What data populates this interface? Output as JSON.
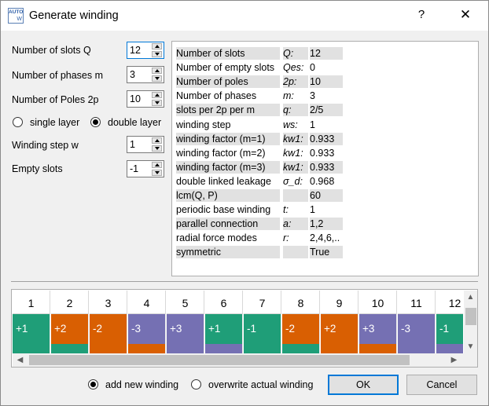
{
  "window": {
    "title": "Generate winding",
    "icon_text_top": "AUTO",
    "icon_text_bottom": "W",
    "help": "?",
    "close": "✕"
  },
  "params": {
    "slots_label": "Number of slots Q",
    "slots_value": "12",
    "phases_label": "Number of phases m",
    "phases_value": "3",
    "poles_label": "Number of Poles 2p",
    "poles_value": "10",
    "single_layer_label": "single layer",
    "double_layer_label": "double layer",
    "layer_selected": "double",
    "step_label": "Winding step w",
    "step_value": "1",
    "empty_label": "Empty slots",
    "empty_value": "-1"
  },
  "info_rows": [
    {
      "name": "Number of slots",
      "sym": "Q:",
      "val": "12",
      "shaded": true
    },
    {
      "name": "Number of empty slots",
      "sym": "Qes:",
      "val": "0",
      "shaded": false
    },
    {
      "name": "Number of poles",
      "sym": "2p:",
      "val": "10",
      "shaded": true
    },
    {
      "name": "Number of phases",
      "sym": "m:",
      "val": "3",
      "shaded": false
    },
    {
      "name": "slots per 2p per m",
      "sym": "q:",
      "val": "2/5",
      "shaded": true
    },
    {
      "name": "winding step",
      "sym": "ws:",
      "val": "1",
      "shaded": false
    },
    {
      "name": "winding factor (m=1)",
      "sym": "kw1:",
      "val": "0.933",
      "shaded": true
    },
    {
      "name": "winding factor (m=2)",
      "sym": "kw1:",
      "val": "0.933",
      "shaded": false
    },
    {
      "name": "winding factor (m=3)",
      "sym": "kw1:",
      "val": "0.933",
      "shaded": true
    },
    {
      "name": "double linked leakage",
      "sym": "σ_d:",
      "val": "0.968",
      "shaded": false
    },
    {
      "name": "lcm(Q, P)",
      "sym": "",
      "val": "60",
      "shaded": true
    },
    {
      "name": "periodic base winding",
      "sym": "t:",
      "val": "1",
      "shaded": false
    },
    {
      "name": "parallel connection",
      "sym": "a:",
      "val": "1,2",
      "shaded": true
    },
    {
      "name": "radial force modes",
      "sym": "r:",
      "val": "2,4,6,..",
      "shaded": false
    },
    {
      "name": "symmetric",
      "sym": "",
      "val": "True",
      "shaded": true
    }
  ],
  "slots": [
    {
      "num": "1",
      "top": "+1",
      "top_color": "#1f9e78",
      "bottom_color": "#1f9e78"
    },
    {
      "num": "2",
      "top": "+2",
      "top_color": "#d95f02",
      "bottom_color": "#1f9e78"
    },
    {
      "num": "3",
      "top": "-2",
      "top_color": "#d95f02",
      "bottom_color": "#d95f02"
    },
    {
      "num": "4",
      "top": "-3",
      "top_color": "#7570b3",
      "bottom_color": "#d95f02"
    },
    {
      "num": "5",
      "top": "+3",
      "top_color": "#7570b3",
      "bottom_color": "#7570b3"
    },
    {
      "num": "6",
      "top": "+1",
      "top_color": "#1f9e78",
      "bottom_color": "#7570b3"
    },
    {
      "num": "7",
      "top": "-1",
      "top_color": "#1f9e78",
      "bottom_color": "#1f9e78"
    },
    {
      "num": "8",
      "top": "-2",
      "top_color": "#d95f02",
      "bottom_color": "#1f9e78"
    },
    {
      "num": "9",
      "top": "+2",
      "top_color": "#d95f02",
      "bottom_color": "#d95f02"
    },
    {
      "num": "10",
      "top": "+3",
      "top_color": "#7570b3",
      "bottom_color": "#d95f02"
    },
    {
      "num": "11",
      "top": "-3",
      "top_color": "#7570b3",
      "bottom_color": "#7570b3"
    },
    {
      "num": "12",
      "top": "-1",
      "top_color": "#1f9e78",
      "bottom_color": "#7570b3"
    }
  ],
  "footer": {
    "add_label": "add new winding",
    "overwrite_label": "overwrite actual winding",
    "mode_selected": "add",
    "ok_label": "OK",
    "cancel_label": "Cancel"
  }
}
